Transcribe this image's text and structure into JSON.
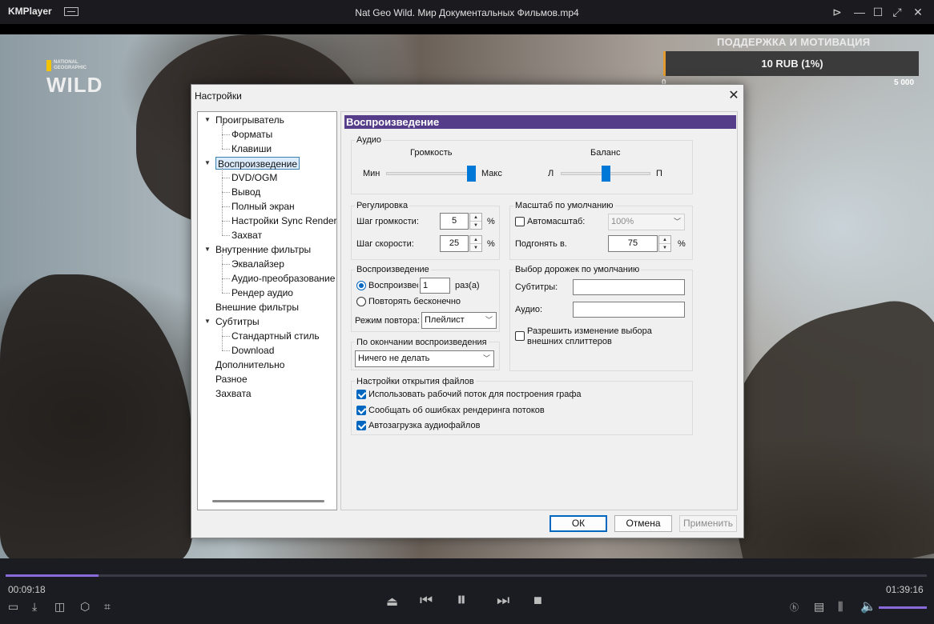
{
  "player": {
    "app_name": "KMPlayer",
    "file_title": "Nat Geo Wild. Мир Документальных Фильмов.mp4",
    "elapsed": "00:09:18",
    "duration": "01:39:16",
    "progress": 0.101
  },
  "video": {
    "logo_small": "NATIONAL GEOGRAPHIC",
    "logo_wild": "WILD",
    "donation": {
      "title": "ПОДДЕРЖКА И МОТИВАЦИЯ",
      "amount": "10 RUB (1%)",
      "min": "0",
      "max": "5 000"
    }
  },
  "dialog": {
    "title": "Настройки",
    "tree": [
      {
        "label": "Проигрыватель",
        "level": 0
      },
      {
        "label": "Форматы",
        "level": 1
      },
      {
        "label": "Клавиши",
        "level": 1
      },
      {
        "label": "Воспроизведение",
        "level": 0
      },
      {
        "label": "DVD/OGM",
        "level": 1
      },
      {
        "label": "Вывод",
        "level": 1
      },
      {
        "label": "Полный экран",
        "level": 1
      },
      {
        "label": "Настройки Sync Render",
        "level": 1
      },
      {
        "label": "Захват",
        "level": 1
      },
      {
        "label": "Внутренние фильтры",
        "level": 0
      },
      {
        "label": "Эквалайзер",
        "level": 1
      },
      {
        "label": "Аудио-преобразование",
        "level": 1
      },
      {
        "label": "Рендер аудио",
        "level": 1
      },
      {
        "label": "Внешние фильтры",
        "level": 0
      },
      {
        "label": "Субтитры",
        "level": 0
      },
      {
        "label": "Стандартный стиль",
        "level": 1
      },
      {
        "label": "Download",
        "level": 1
      },
      {
        "label": "Дополнительно",
        "level": 0
      },
      {
        "label": "Разное",
        "level": 0
      },
      {
        "label": "Захвата",
        "level": 0
      }
    ],
    "panel_title": "Воспроизведение",
    "audio": {
      "group": "Аудио",
      "volume_label": "Громкость",
      "volume_min": "Мин",
      "volume_max": "Макс",
      "volume_value": 0.95,
      "balance_label": "Баланс",
      "balance_left": "Л",
      "balance_right": "П",
      "balance_value": 0.5
    },
    "adjust": {
      "group": "Регулировка",
      "volume_step_label": "Шаг громкости:",
      "volume_step": "5",
      "speed_step_label": "Шаг скорости:",
      "speed_step": "25",
      "unit": "%"
    },
    "scale": {
      "group": "Масштаб по умолчанию",
      "auto_label": "Автомасштаб:",
      "auto_value": "100%",
      "fit_label": "Подгонять в.",
      "fit_value": "75",
      "unit": "%"
    },
    "playback": {
      "group": "Воспроизведение",
      "play_label": "Воспроизвес",
      "play_count": "1",
      "times_label": "раз(а)",
      "loop_label": "Повторять бесконечно",
      "repeat_mode_label": "Режим повтора:",
      "repeat_mode_value": "Плейлист"
    },
    "tracks": {
      "group": "Выбор дорожек по умолчанию",
      "subtitles_label": "Субтитры:",
      "audio_label": "Аудио:",
      "splitters_label_1": "Разрешить изменение выбора",
      "splitters_label_2": "внешних сплиттеров"
    },
    "on_end": {
      "group": "По окончании воспроизведения",
      "value": "Ничего не делать"
    },
    "file_open": {
      "group": "Настройки открытия файлов",
      "opt1": "Использовать рабочий поток для построения графа",
      "opt2": "Сообщать об ошибках рендеринга потоков",
      "opt3": "Автозагрузка аудиофайлов"
    },
    "buttons": {
      "ok": "ОК",
      "cancel": "Отмена",
      "apply": "Применить"
    }
  },
  "colors": {
    "accent": "#563d8a",
    "progress": "#8a6ad8",
    "selection": "#0067c0"
  }
}
